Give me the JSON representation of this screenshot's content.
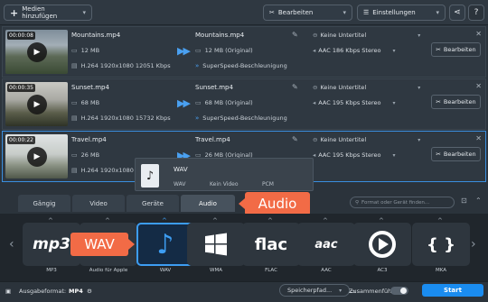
{
  "toolbar": {
    "add_media_label": "Medien hinzufügen",
    "edit_label": "Bearbeiten",
    "settings_label": "Einstellungen"
  },
  "files": [
    {
      "duration": "00:00:08",
      "name": "Mountains.mp4",
      "size": "12 MB",
      "video_info": "H.264 1920x1080 12051 Kbps",
      "output_name": "Mountains.mp4",
      "output_size": "12 MB (Original)",
      "superspeed": "SuperSpeed-Beschleunigung",
      "subtitles": "Keine Untertitel",
      "audio": "AAC 186 Kbps Stereo",
      "edit_label": "Bearbeiten"
    },
    {
      "duration": "00:00:35",
      "name": "Sunset.mp4",
      "size": "68 MB",
      "video_info": "H.264 1920x1080 15732 Kbps",
      "output_name": "Sunset.mp4",
      "output_size": "68 MB (Original)",
      "superspeed": "SuperSpeed-Beschleunigung",
      "subtitles": "Keine Untertitel",
      "audio": "AAC 195 Kbps Stereo",
      "edit_label": "Bearbeiten"
    },
    {
      "duration": "00:00:22",
      "name": "Travel.mp4",
      "size": "26 MB",
      "video_info": "H.264 1920x1080 8",
      "output_name": "Travel.mp4",
      "output_size": "26 MB (Original)",
      "superspeed": "",
      "subtitles": "Keine Untertitel",
      "audio": "AAC 195 Kbps Stereo",
      "edit_label": "Bearbeiten"
    }
  ],
  "popup": {
    "title": "WAV",
    "info_format": "WAV",
    "info_video": "Kein Video",
    "info_codec": "PCM"
  },
  "tabs": [
    {
      "label": "Gängig",
      "active": false
    },
    {
      "label": "Video",
      "active": false
    },
    {
      "label": "Geräte",
      "active": false
    },
    {
      "label": "Audio",
      "active": true
    }
  ],
  "search_placeholder": "Format oder Gerät finden...",
  "formats": [
    {
      "label": "MP3",
      "logo": "mp3"
    },
    {
      "label": "Audio für Apple",
      "logo": ""
    },
    {
      "label": "WAV",
      "logo": "♪",
      "active": true
    },
    {
      "label": "WMA",
      "logo": ""
    },
    {
      "label": "FLAC",
      "logo": "flac"
    },
    {
      "label": "AAC",
      "logo": "aac"
    },
    {
      "label": "AC3",
      "logo": ""
    },
    {
      "label": "MKA",
      "logo": "{ }"
    }
  ],
  "callouts": {
    "audio": "Audio",
    "wav": "WAV"
  },
  "statusbar": {
    "output_format_label": "Ausgabeformat:",
    "output_format_value": "MP4",
    "save_path": "Speicherpfad...",
    "merge_label": "Zusammenführen:",
    "start_label": "Start"
  },
  "colors": {
    "accent": "#3d9df2",
    "callout": "#f26b46",
    "start": "#1a8cf0"
  }
}
